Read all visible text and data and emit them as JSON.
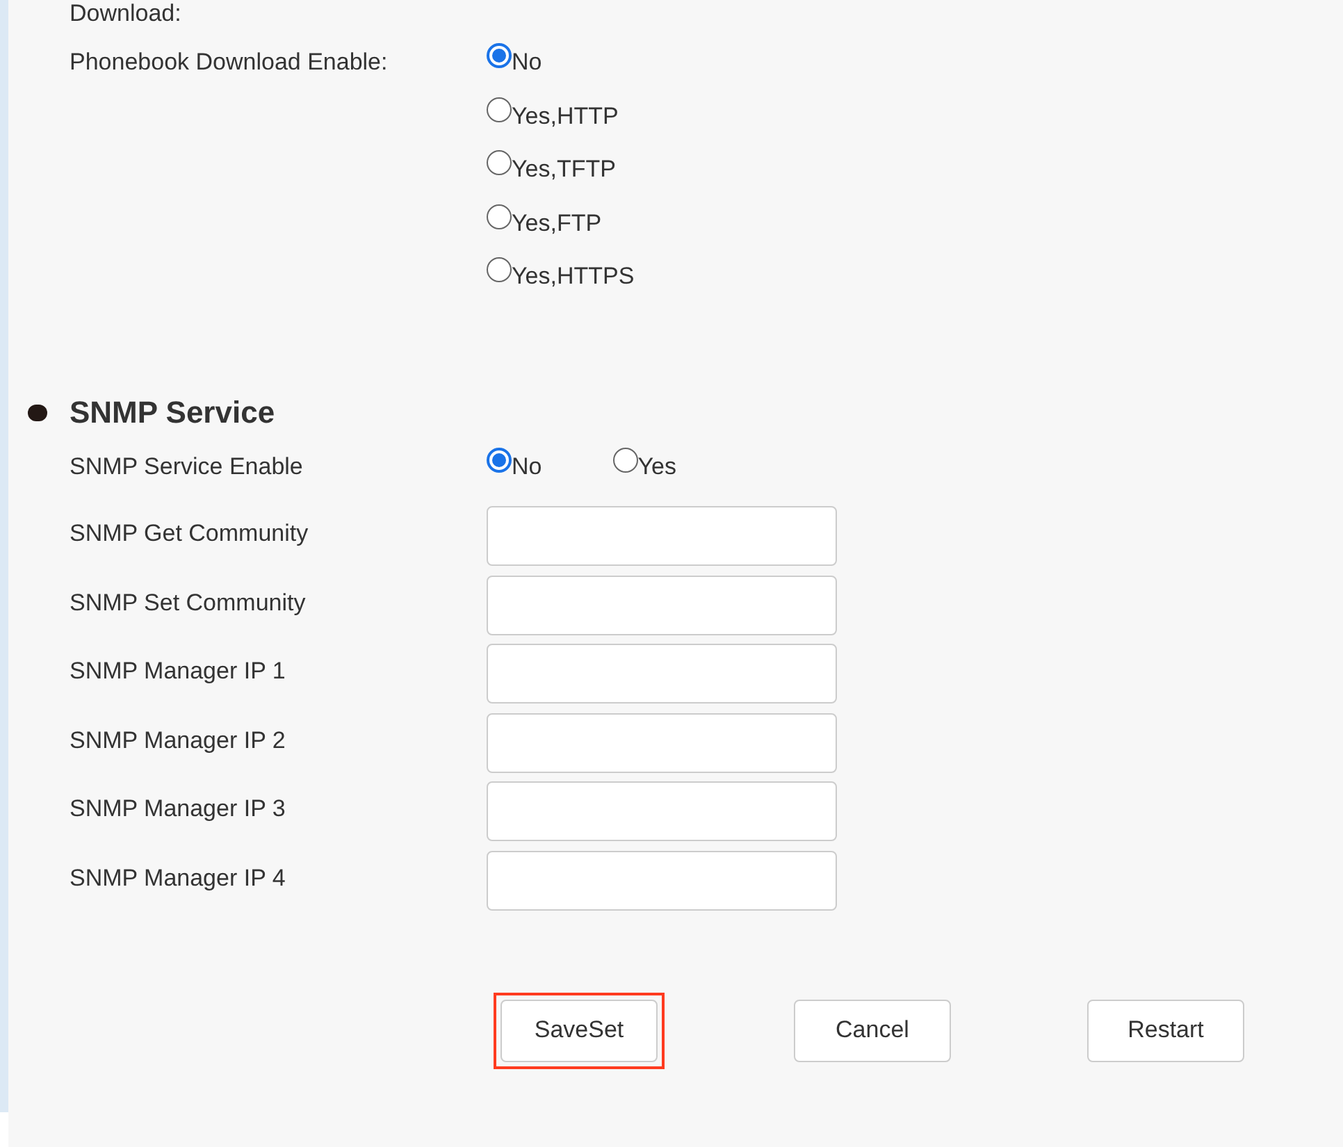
{
  "section_top": {
    "trailing_label": "Download:",
    "fields": [
      {
        "label": "Phonebook Download Enable:",
        "kind": "radiocolumn",
        "options": [
          {
            "label": "No",
            "selected": true
          },
          {
            "label": "Yes,HTTP",
            "selected": false
          },
          {
            "label": "Yes,TFTP",
            "selected": false
          },
          {
            "label": "Yes,FTP",
            "selected": false
          },
          {
            "label": "Yes,HTTPS",
            "selected": false
          }
        ]
      }
    ]
  },
  "snmp": {
    "title": "SNMP Service",
    "fields": [
      {
        "label": "SNMP Service Enable",
        "kind": "radiorow",
        "options": [
          {
            "label": "No",
            "selected": true
          },
          {
            "label": "Yes",
            "selected": false
          }
        ]
      },
      {
        "label": "SNMP Get Community",
        "kind": "text"
      },
      {
        "label": "SNMP Set Community",
        "kind": "text"
      },
      {
        "label": "SNMP Manager IP 1",
        "kind": "text"
      },
      {
        "label": "SNMP Manager IP 2",
        "kind": "text"
      },
      {
        "label": "SNMP Manager IP 3",
        "kind": "text"
      },
      {
        "label": "SNMP Manager IP 4",
        "kind": "text"
      }
    ]
  },
  "buttons": [
    {
      "label": "SaveSet",
      "highlighted": true
    },
    {
      "label": "Cancel",
      "highlighted": false
    },
    {
      "label": "Restart",
      "highlighted": false
    }
  ]
}
